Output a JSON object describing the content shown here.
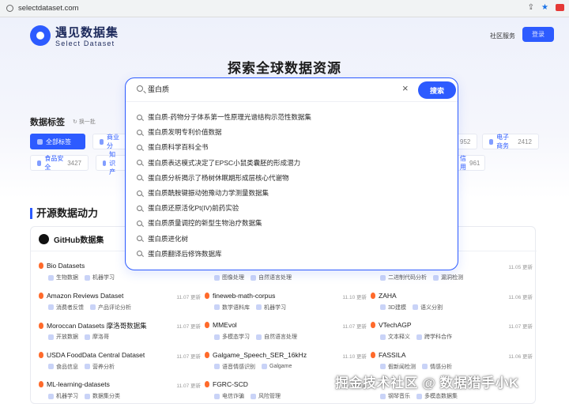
{
  "browser": {
    "url": "selectdataset.com"
  },
  "header": {
    "logo_cn": "遇见数据集",
    "logo_en": "Select Dataset",
    "nav_community": "社区服务",
    "login": "登录"
  },
  "hero": {
    "title": "探索全球数据资源"
  },
  "search": {
    "value": "蛋白质",
    "button": "搜索",
    "suggestions": [
      "蛋白质-药物分子体系第一性原理光谱结构示范性数据集",
      "蛋白质发明专利价值数据",
      "蛋白质科学百科全书",
      "蛋白质表达模式决定了EPSC小鼠类囊胚的形成潜力",
      "蛋白质分析揭示了杨树休眠期形成层核心代谢物",
      "蛋白质酰胺键振动弛豫动力学测量数据集",
      "蛋白质还原活化Pt(IV)前药实验",
      "蛋白质质量调控的新型生物治疗数据集",
      "蛋白质进化树",
      "蛋白质翻译后修饰数据库"
    ]
  },
  "tags": {
    "title": "数据标签",
    "refresh": "换一批",
    "chips": [
      {
        "label": "全部标签",
        "count": ""
      },
      {
        "label": "商业分",
        "count": ""
      },
      {
        "label": "",
        "count": "952"
      },
      {
        "label": "电子商务",
        "count": "2412"
      },
      {
        "label": "食品安全",
        "count": "3427"
      },
      {
        "label": "知识产",
        "count": ""
      },
      {
        "label": "信用",
        "count": "961"
      }
    ]
  },
  "opensource": {
    "title": "开源数据动力",
    "card_title": "GitHub数据集",
    "columns": [
      [
        {
          "name": "Bio Datasets",
          "date": "",
          "tags": [
            "生物数据",
            "机器学习"
          ]
        },
        {
          "name": "Amazon Reviews Dataset",
          "date": "11.07 更新",
          "tags": [
            "消费者反馈",
            "产品评论分析"
          ]
        },
        {
          "name": "Moroccan Datasets 摩洛哥数据集",
          "date": "11.07 更新",
          "tags": [
            "开放数据",
            "摩洛哥"
          ]
        },
        {
          "name": "USDA FoodData Central Dataset",
          "date": "11.07 更新",
          "tags": [
            "食品信息",
            "营养分析"
          ]
        },
        {
          "name": "ML-learning-datasets",
          "date": "11.07 更新",
          "tags": [
            "机器学习",
            "数据集分类"
          ]
        }
      ],
      [
        {
          "name": "",
          "date": "",
          "tags": [
            "图像处理",
            "自然语言处理"
          ]
        },
        {
          "name": "fineweb-math-corpus",
          "date": "11.10 更新",
          "tags": [
            "数学语料库",
            "机器学习"
          ]
        },
        {
          "name": "MMEvol",
          "date": "11.07 更新",
          "tags": [
            "多模态学习",
            "自然语言处理"
          ]
        },
        {
          "name": "Galgame_Speech_SER_16kHz",
          "date": "11.10 更新",
          "tags": [
            "语音情感识别",
            "Galgame"
          ]
        },
        {
          "name": "FGRC-SCD",
          "date": "11.07 更新",
          "tags": [
            "电信诈骗",
            "风险管理"
          ]
        }
      ],
      [
        {
          "name": "",
          "date": "11.05 更新",
          "tags": [
            "二进制代码分析",
            "漏洞检测"
          ]
        },
        {
          "name": "ZAHA",
          "date": "11.06 更新",
          "tags": [
            "3D建模",
            "语义分割"
          ]
        },
        {
          "name": "VTechAGP",
          "date": "11.07 更新",
          "tags": [
            "文本释义",
            "跨学科合作"
          ]
        },
        {
          "name": "FASSILA",
          "date": "11.06 更新",
          "tags": [
            "假新闻检测",
            "情感分析"
          ]
        },
        {
          "name": "",
          "date": "",
          "tags": [
            "钢琴音乐",
            "多模态数据集"
          ]
        }
      ]
    ]
  },
  "watermark": "掘金技术社区 @ 数据猎手小K",
  "colors": {
    "accent": "#2d5bff",
    "fire": "#ff6a2b"
  }
}
